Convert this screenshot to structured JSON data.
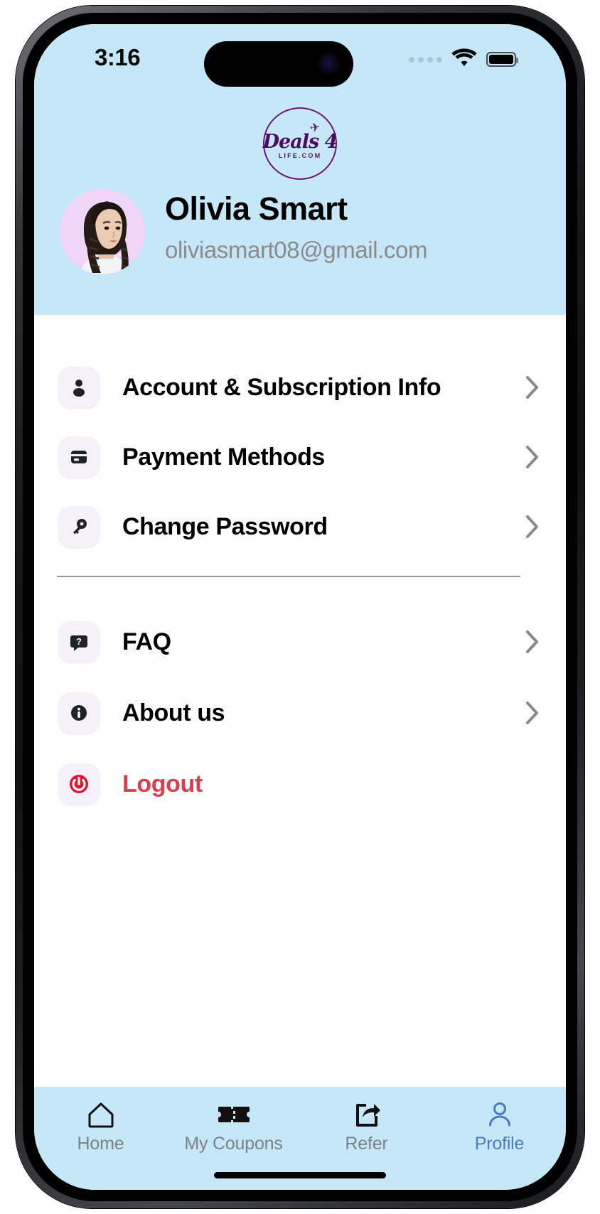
{
  "status_bar": {
    "time": "3:16",
    "signal_icon": "signal-dots-icon",
    "wifi_icon": "wifi-icon",
    "battery_icon": "battery-icon"
  },
  "brand": {
    "logo_main": "Deals 4",
    "logo_sub": "LIFE.COM",
    "plane_icon": "airplane-icon",
    "color": "#4b0d5c"
  },
  "profile": {
    "avatar_alt": "user-avatar",
    "name": "Olivia Smart",
    "email": "oliviasmart08@gmail.com"
  },
  "menu": {
    "group_one": [
      {
        "label": "Account & Subscription Info",
        "icon": "person-icon",
        "chevron": "chevron-right-icon"
      },
      {
        "label": "Payment Methods",
        "icon": "credit-card-icon",
        "chevron": "chevron-right-icon"
      },
      {
        "label": "Change Password",
        "icon": "key-icon",
        "chevron": "chevron-right-icon"
      }
    ],
    "group_two": [
      {
        "label": "FAQ",
        "icon": "question-bubble-icon",
        "chevron": "chevron-right-icon"
      },
      {
        "label": "About us",
        "icon": "info-circle-icon",
        "chevron": "chevron-right-icon"
      }
    ],
    "logout": {
      "label": "Logout",
      "icon": "power-icon",
      "color": "#d64050"
    }
  },
  "tab_bar": {
    "items": [
      {
        "label": "Home",
        "icon": "home-icon",
        "active": false
      },
      {
        "label": "My Coupons",
        "icon": "ticket-icon",
        "active": false
      },
      {
        "label": "Refer",
        "icon": "share-icon",
        "active": false
      },
      {
        "label": "Profile",
        "icon": "person-outline-icon",
        "active": true
      }
    ],
    "active_color": "#4a7cc0",
    "inactive_color": "#7c8288",
    "background": "#c5e7f7"
  },
  "theme": {
    "header_bg": "#c5e7f7",
    "body_bg": "#ffffff",
    "icon_chip_bg": "#f5f1f8"
  }
}
